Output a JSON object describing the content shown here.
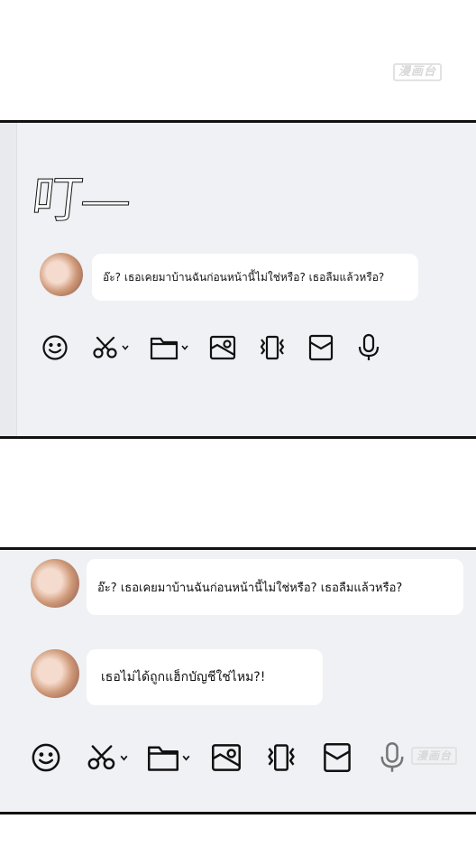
{
  "watermark": {
    "text": "漫画台"
  },
  "sound_effect": {
    "text": "叮—"
  },
  "panel1": {
    "message": {
      "text": "อ๊ะ? เธอเคยมาบ้านฉันก่อนหน้านี้ไม่ใช่หรือ? เธอลืมแล้วหรือ?"
    }
  },
  "panel2": {
    "messages": [
      {
        "text": "อ๊ะ? เธอเคยมาบ้านฉันก่อนหน้านี้ไม่ใช่หรือ? เธอลืมแล้วหรือ?"
      },
      {
        "text": "เธอไม่ได้ถูกแฮ็กบัญชีใช่ไหม?!"
      }
    ]
  },
  "toolbar_icons": [
    "smile-icon",
    "scissors-icon",
    "folder-icon",
    "image-icon",
    "shake-icon",
    "envelope-icon",
    "microphone-icon"
  ],
  "colors": {
    "panel_bg": "#eff1f4",
    "bubble_bg": "#ffffff",
    "border": "#111111"
  }
}
